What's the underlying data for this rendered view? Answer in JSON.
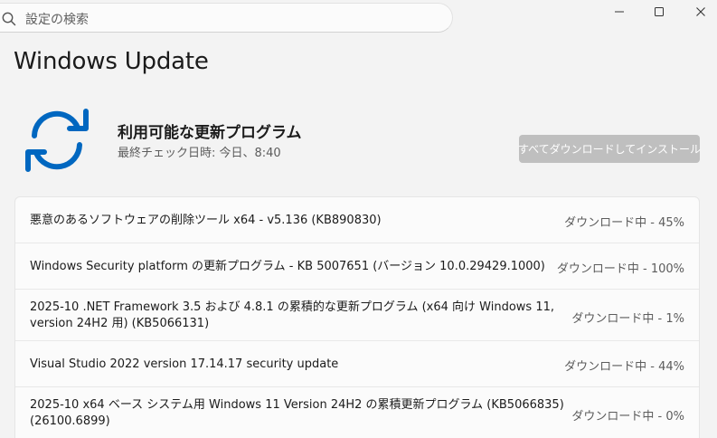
{
  "search": {
    "placeholder": "設定の検索"
  },
  "page": {
    "title": "Windows Update"
  },
  "status": {
    "title": "利用可能な更新プログラム",
    "last_checked": "最終チェック日時: 今日、8:40",
    "install_all_label": "すべてダウンロードしてインストール"
  },
  "updates": [
    {
      "name": "悪意のあるソフトウェアの削除ツール x64 - v5.136 (KB890830)",
      "status": "ダウンロード中 - 45%",
      "progress": 45
    },
    {
      "name": "Windows Security platform の更新プログラム - KB 5007651 (バージョン 10.0.29429.1000)",
      "status": "ダウンロード中 - 100%",
      "progress": 100
    },
    {
      "name": "2025-10 .NET Framework 3.5 および 4.8.1 の累積的な更新プログラム (x64 向け Windows 11, version 24H2 用) (KB5066131)",
      "status": "ダウンロード中 - 1%",
      "progress": 1
    },
    {
      "name": "Visual Studio 2022 version 17.14.17 security update",
      "status": "ダウンロード中 - 44%",
      "progress": 44
    },
    {
      "name": "2025-10 x64 ベース システム用 Windows 11 Version 24H2 の累積更新プログラム (KB5066835) (26100.6899)",
      "status": "ダウンロード中 - 0%",
      "progress": 0
    }
  ],
  "colors": {
    "accent": "#0067c0",
    "button_disabled": "#bfbfbf"
  },
  "icons": {
    "search": "search-icon",
    "minimize": "minimize-icon",
    "maximize": "maximize-icon",
    "close": "close-icon",
    "update": "sync-arrows-icon"
  }
}
